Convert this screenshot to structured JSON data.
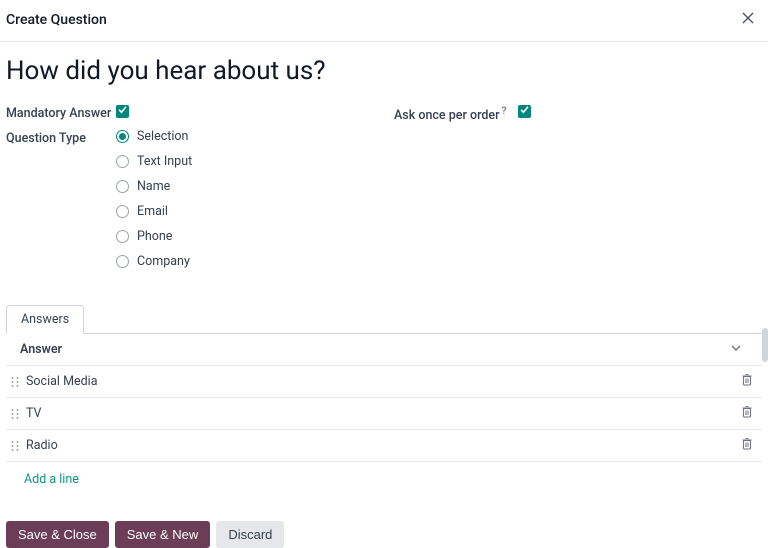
{
  "header": {
    "title": "Create Question"
  },
  "question": {
    "title": "How did you hear about us?"
  },
  "fields": {
    "mandatory_label": "Mandatory Answer",
    "once_label": "Ask once per order",
    "type_label": "Question Type"
  },
  "types": {
    "selection": "Selection",
    "text_input": "Text Input",
    "name": "Name",
    "email": "Email",
    "phone": "Phone",
    "company": "Company"
  },
  "tabs": {
    "answers": "Answers"
  },
  "table": {
    "header": "Answer"
  },
  "answers": [
    {
      "label": "Social Media"
    },
    {
      "label": "TV"
    },
    {
      "label": "Radio"
    }
  ],
  "actions": {
    "add_line": "Add a line",
    "save_close": "Save & Close",
    "save_new": "Save & New",
    "discard": "Discard"
  }
}
